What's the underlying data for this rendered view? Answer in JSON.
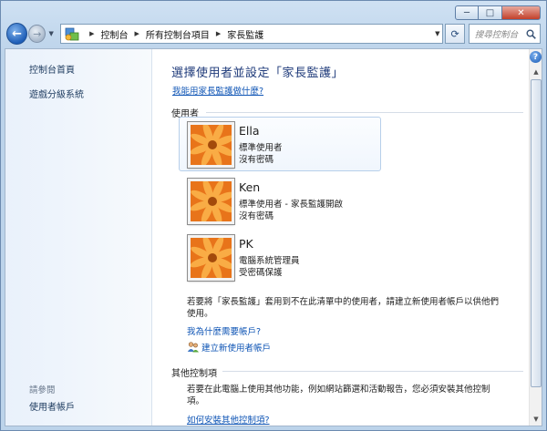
{
  "window": {
    "caption": {
      "minimize": "─",
      "maximize": "□",
      "close": "✕"
    }
  },
  "navbar": {
    "breadcrumb": [
      "控制台",
      "所有控制台項目",
      "家長監護"
    ],
    "search_placeholder": "搜尋控制台"
  },
  "sidebar": {
    "links": [
      "控制台首頁",
      "遊戲分級系統"
    ],
    "see_also_title": "請參閱",
    "see_also_links": [
      "使用者帳戶"
    ]
  },
  "main": {
    "title": "選擇使用者並設定「家長監護」",
    "help_link": "我能用家長監護做什麼?",
    "users_label": "使用者",
    "users": [
      {
        "name": "Ella",
        "line1": "標準使用者",
        "line2": "沒有密碼"
      },
      {
        "name": "Ken",
        "line1": "標準使用者 - 家長監護開啟",
        "line2": "沒有密碼"
      },
      {
        "name": "PK",
        "line1": "電腦系統管理員",
        "line2": "受密碼保護"
      }
    ],
    "note": "若要將「家長監護」套用到不在此清單中的使用者，請建立新使用者帳戶以供他們使用。",
    "why_link": "我為什麼需要帳戶?",
    "create_link": "建立新使用者帳戶",
    "other_label": "其他控制項",
    "other_note": "若要在此電腦上使用其他功能，例如網站篩選和活動報告，您必須安裝其他控制項。",
    "install_link": "如何安裝其他控制項?"
  },
  "colors": {
    "link": "#0f55b5",
    "title": "#1e3a7a",
    "avatar_orange": "#f08a1e"
  }
}
